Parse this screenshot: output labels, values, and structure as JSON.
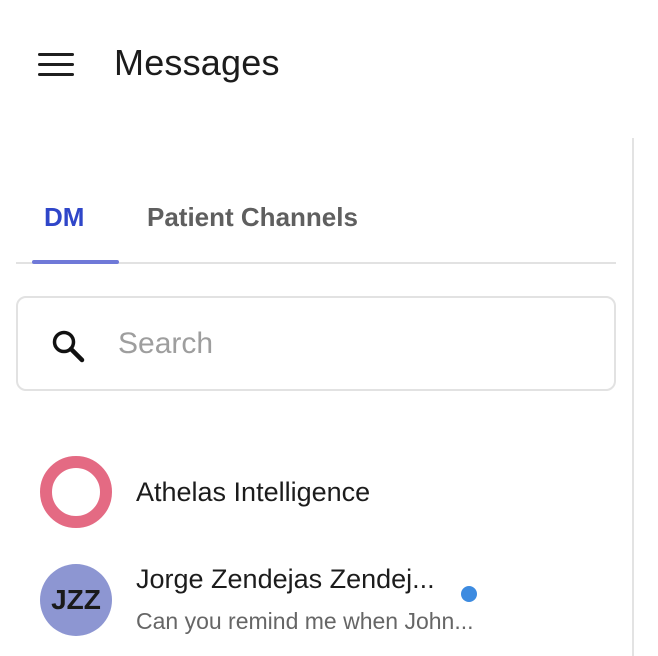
{
  "header": {
    "title": "Messages",
    "menu_icon": "hamburger-menu-icon"
  },
  "tabs": [
    {
      "label": "DM",
      "active": true
    },
    {
      "label": "Patient Channels",
      "active": false
    }
  ],
  "search": {
    "placeholder": "Search",
    "value": "",
    "icon": "search-icon"
  },
  "conversations": [
    {
      "name": "Athelas Intelligence",
      "avatar": {
        "type": "ring",
        "color": "#e46a83"
      },
      "preview": "",
      "unread": false
    },
    {
      "name": "Jorge Zendejas Zendej...",
      "avatar": {
        "type": "initials",
        "initials": "JZZ",
        "color": "#8d96d2"
      },
      "preview": "Can you remind me when John...",
      "unread": true
    }
  ],
  "colors": {
    "accent": "#2f46c9",
    "tab_underline": "#6f79d8",
    "unread_dot": "#3d8be0",
    "athelas_ring": "#e46a83",
    "jzz_avatar": "#8d96d2"
  }
}
